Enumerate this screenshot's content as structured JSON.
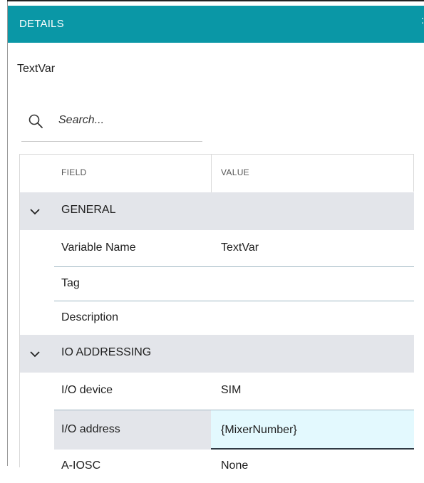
{
  "header": {
    "title": "DETAILS",
    "edge_char": ":"
  },
  "object_name": "TextVar",
  "search": {
    "placeholder": "Search..."
  },
  "grid": {
    "columns": {
      "field": "FIELD",
      "value": "VALUE"
    },
    "groups": [
      {
        "label": "GENERAL",
        "rows": [
          {
            "field": "Variable Name",
            "value": "TextVar"
          },
          {
            "field": "Tag",
            "value": ""
          },
          {
            "field": "Description",
            "value": ""
          }
        ]
      },
      {
        "label": "IO ADDRESSING",
        "rows": [
          {
            "field": "I/O device",
            "value": "SIM"
          },
          {
            "field": "I/O address",
            "value": "{MixerNumber}",
            "selected": true
          },
          {
            "field": "A-IOSC",
            "value": "None"
          }
        ]
      }
    ]
  }
}
